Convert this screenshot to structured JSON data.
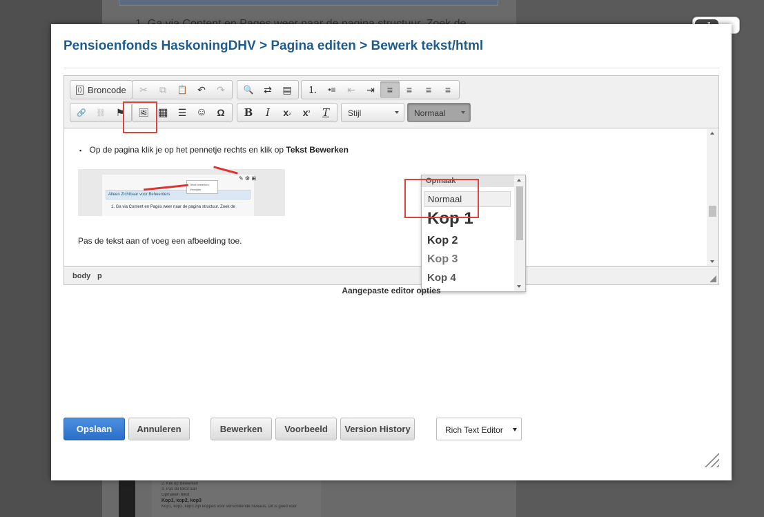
{
  "background": {
    "top_text": "1. Ga via Content en Pages weer naar de pagina structuur. Zoek de",
    "lower_lines": [
      "2. Klik op Bewerken",
      "3. Pas de tekst aan",
      "Opmaken tekst",
      "Kop1, kop2, kop3",
      "Kop1, kop2, kop3 zijn koppen voor verschillende niveaus. Dit is goed voor"
    ]
  },
  "window": {
    "expand_glyph": "⤢",
    "close_glyph": "✖"
  },
  "modal": {
    "title": "Pensioenfonds HaskoningDHV > Pagina editen > Bewerk tekst/html"
  },
  "toolbar": {
    "source_label": "Broncode",
    "style_combo": "Stijl",
    "format_combo": "Normaal",
    "icons": {
      "source": "⟨⟩",
      "cut": "✂",
      "copy": "⧉",
      "paste": "📋",
      "undo": "↶",
      "redo": "↷",
      "find": "🔍",
      "replace": "⇄",
      "select_all": "▤",
      "numlist": "⒈",
      "bullist": "•≡",
      "outdent": "⇤",
      "indent": "⇥",
      "align_left": "≡",
      "align_right": "≡",
      "align_center": "≡",
      "align_justify": "≡",
      "link": "🔗",
      "unlink": "⛓",
      "anchor": "⚑",
      "image": "🖼",
      "table": "▦",
      "hr": "☰",
      "emoticon": "☺",
      "charmap": "Ω",
      "bold": "B",
      "italic": "I",
      "subscript": "x",
      "subscript_mark": "₂",
      "superscript": "x",
      "superscript_mark": "²",
      "clear": "T"
    }
  },
  "content": {
    "bullet_text": "Op de pagina klik je op het pennetje rechts en klik op ",
    "bullet_bold": "Tekst Bewerken",
    "shot_bar": "Alleen Zichtbaar voor Beheerders",
    "shot_text": "1. Ga via Content en Pages weer naar de pagina structuur. Zoek de",
    "shot_menu": "Tekst bewerken",
    "shot_menu2": "Verwijder",
    "paragraph": "Pas de tekst aan of voeg een afbeelding toe."
  },
  "statusbar": {
    "path1": "body",
    "path2": "p"
  },
  "dropdown": {
    "header": "Opmaak",
    "items": [
      "Normaal",
      "Kop 1",
      "Kop 2",
      "Kop 3",
      "Kop 4"
    ]
  },
  "editor_options_label": "Aangepaste editor opties",
  "buttons": {
    "save": "Opslaan",
    "cancel": "Annuleren",
    "edit": "Bewerken",
    "preview": "Voorbeeld",
    "history": "Version History",
    "editor_select": "Rich Text Editor"
  },
  "colors": {
    "title": "#1f5c8b",
    "primary": "#2a6ec9",
    "highlight": "#d9453b"
  }
}
